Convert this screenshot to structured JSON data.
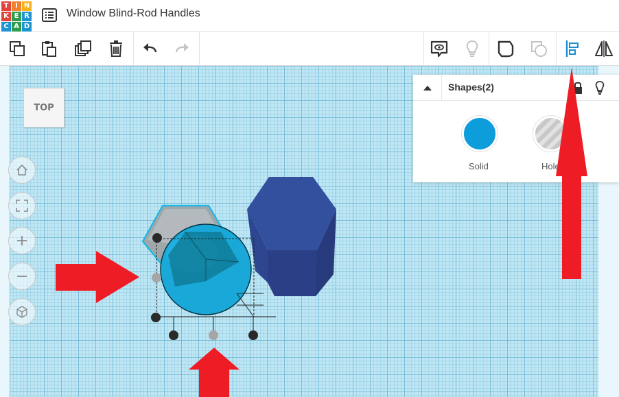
{
  "app": {
    "logo_letters": [
      "T",
      "I",
      "N",
      "K",
      "E",
      "R",
      "C",
      "A",
      "D"
    ],
    "logo_colors": [
      "#e0443a",
      "#f1822b",
      "#f6b21b",
      "#e0443a",
      "#2f9d4c",
      "#1f94d2",
      "#1f94d2",
      "#2f9d4c",
      "#1f94d2"
    ],
    "document_title": "Window Blind-Rod Handles"
  },
  "toolbar": {
    "left_tools": [
      "copy-icon",
      "paste-icon",
      "duplicate-icon",
      "delete-icon",
      "undo-icon",
      "redo-icon"
    ],
    "right_tools": [
      "notes-icon",
      "light-bulb-icon",
      "group-icon",
      "ungroup-icon",
      "align-icon",
      "mirror-icon"
    ]
  },
  "workplane": {
    "view_cube_label": "TOP",
    "nav_controls": [
      "home-icon",
      "fit-view-icon",
      "zoom-in-icon",
      "zoom-out-icon",
      "perspective-icon"
    ]
  },
  "inspector": {
    "title": "Shapes(2)",
    "options": [
      {
        "label": "Solid",
        "color": "#0d9ddb"
      },
      {
        "label": "Hole",
        "color": "#c8c8c8"
      }
    ]
  },
  "colors": {
    "accent": "#0d9ddb",
    "shape_blue": "#2f4a9a",
    "annotation_red": "#ee1c25"
  }
}
